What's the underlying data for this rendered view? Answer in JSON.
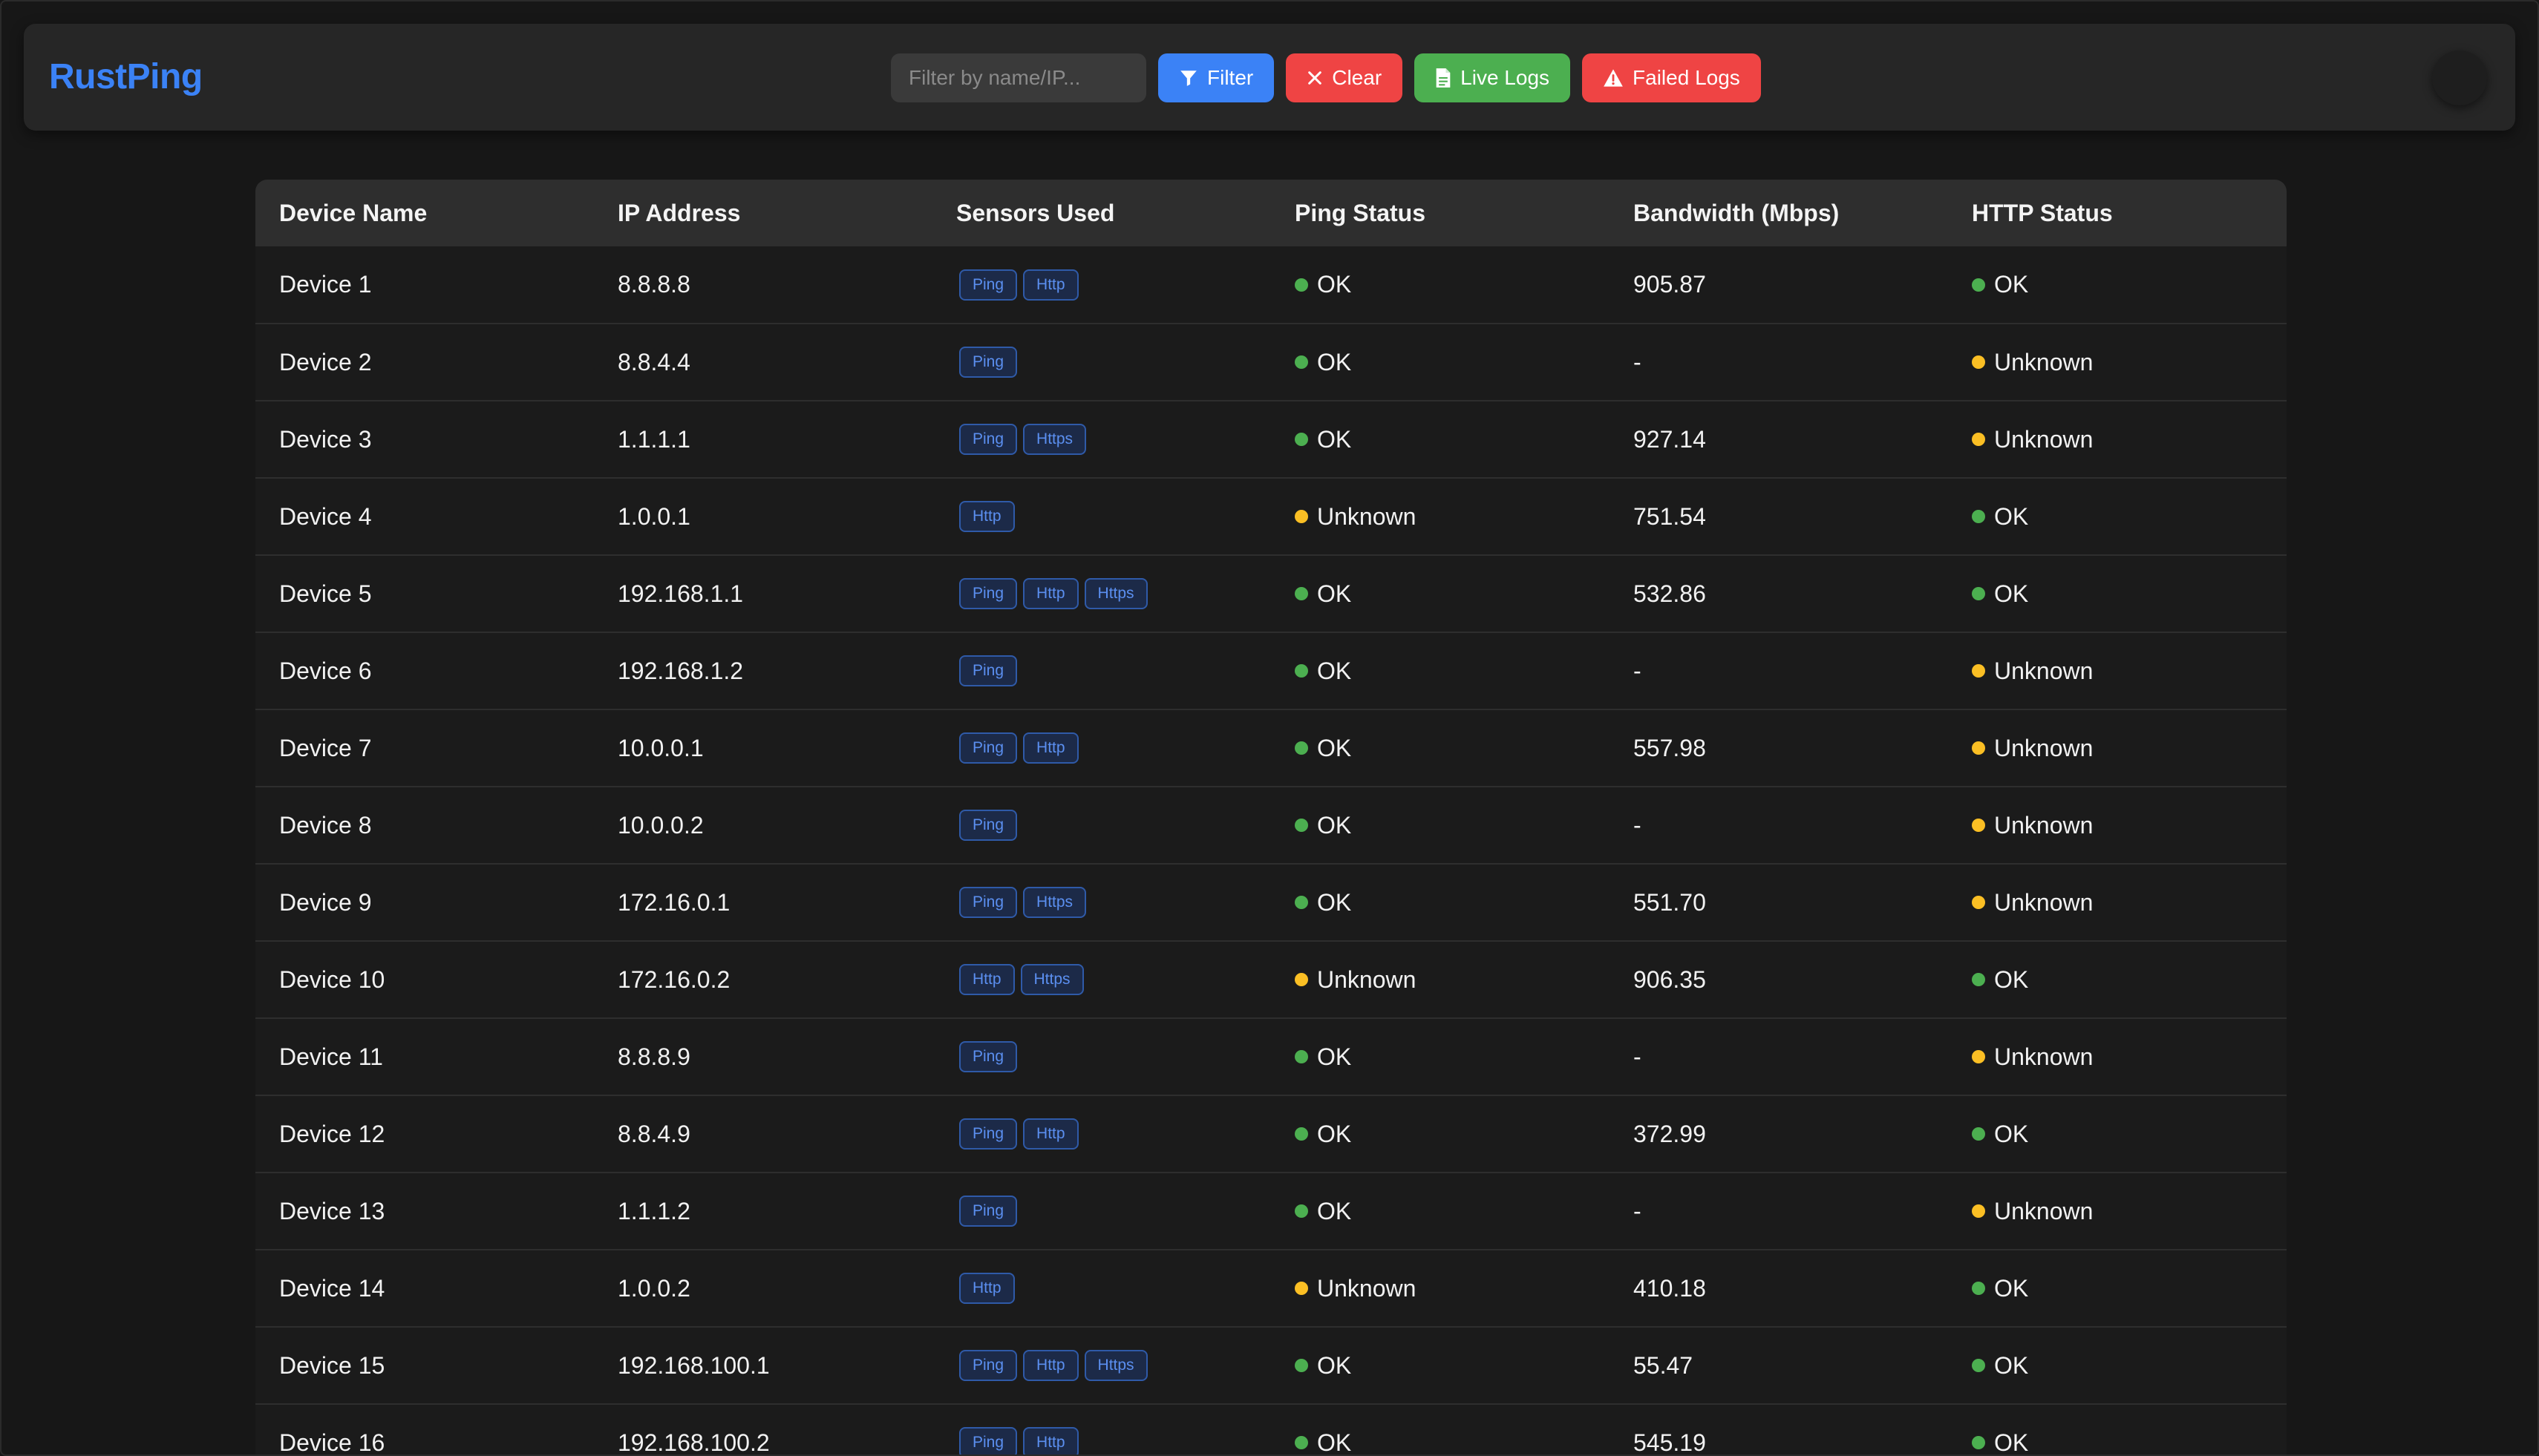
{
  "app": {
    "title": "RustPing"
  },
  "toolbar": {
    "filter_placeholder": "Filter by name/IP...",
    "filter_value": "",
    "filter_label": "Filter",
    "clear_label": "Clear",
    "live_logs_label": "Live Logs",
    "failed_logs_label": "Failed Logs",
    "theme_toggle_icon": "moon-icon"
  },
  "colors": {
    "brand": "#3b82f6",
    "filter_button": "#3b82f6",
    "clear_button": "#ef4444",
    "live_logs_button": "#4caf50",
    "failed_logs_button": "#ef4444",
    "status_ok": "#4caf50",
    "status_unknown": "#fbbf24"
  },
  "table": {
    "columns": [
      "Device Name",
      "IP Address",
      "Sensors Used",
      "Ping Status",
      "Bandwidth (Mbps)",
      "HTTP Status"
    ],
    "rows": [
      {
        "name": "Device 1",
        "ip": "8.8.8.8",
        "sensors": [
          "Ping",
          "Http"
        ],
        "ping": "OK",
        "bandwidth": "905.87",
        "http": "OK"
      },
      {
        "name": "Device 2",
        "ip": "8.8.4.4",
        "sensors": [
          "Ping"
        ],
        "ping": "OK",
        "bandwidth": "-",
        "http": "Unknown"
      },
      {
        "name": "Device 3",
        "ip": "1.1.1.1",
        "sensors": [
          "Ping",
          "Https"
        ],
        "ping": "OK",
        "bandwidth": "927.14",
        "http": "Unknown"
      },
      {
        "name": "Device 4",
        "ip": "1.0.0.1",
        "sensors": [
          "Http"
        ],
        "ping": "Unknown",
        "bandwidth": "751.54",
        "http": "OK"
      },
      {
        "name": "Device 5",
        "ip": "192.168.1.1",
        "sensors": [
          "Ping",
          "Http",
          "Https"
        ],
        "ping": "OK",
        "bandwidth": "532.86",
        "http": "OK"
      },
      {
        "name": "Device 6",
        "ip": "192.168.1.2",
        "sensors": [
          "Ping"
        ],
        "ping": "OK",
        "bandwidth": "-",
        "http": "Unknown"
      },
      {
        "name": "Device 7",
        "ip": "10.0.0.1",
        "sensors": [
          "Ping",
          "Http"
        ],
        "ping": "OK",
        "bandwidth": "557.98",
        "http": "Unknown"
      },
      {
        "name": "Device 8",
        "ip": "10.0.0.2",
        "sensors": [
          "Ping"
        ],
        "ping": "OK",
        "bandwidth": "-",
        "http": "Unknown"
      },
      {
        "name": "Device 9",
        "ip": "172.16.0.1",
        "sensors": [
          "Ping",
          "Https"
        ],
        "ping": "OK",
        "bandwidth": "551.70",
        "http": "Unknown"
      },
      {
        "name": "Device 10",
        "ip": "172.16.0.2",
        "sensors": [
          "Http",
          "Https"
        ],
        "ping": "Unknown",
        "bandwidth": "906.35",
        "http": "OK"
      },
      {
        "name": "Device 11",
        "ip": "8.8.8.9",
        "sensors": [
          "Ping"
        ],
        "ping": "OK",
        "bandwidth": "-",
        "http": "Unknown"
      },
      {
        "name": "Device 12",
        "ip": "8.8.4.9",
        "sensors": [
          "Ping",
          "Http"
        ],
        "ping": "OK",
        "bandwidth": "372.99",
        "http": "OK"
      },
      {
        "name": "Device 13",
        "ip": "1.1.1.2",
        "sensors": [
          "Ping"
        ],
        "ping": "OK",
        "bandwidth": "-",
        "http": "Unknown"
      },
      {
        "name": "Device 14",
        "ip": "1.0.0.2",
        "sensors": [
          "Http"
        ],
        "ping": "Unknown",
        "bandwidth": "410.18",
        "http": "OK"
      },
      {
        "name": "Device 15",
        "ip": "192.168.100.1",
        "sensors": [
          "Ping",
          "Http",
          "Https"
        ],
        "ping": "OK",
        "bandwidth": "55.47",
        "http": "OK"
      },
      {
        "name": "Device 16",
        "ip": "192.168.100.2",
        "sensors": [
          "Ping",
          "Http"
        ],
        "ping": "OK",
        "bandwidth": "545.19",
        "http": "OK"
      }
    ]
  }
}
